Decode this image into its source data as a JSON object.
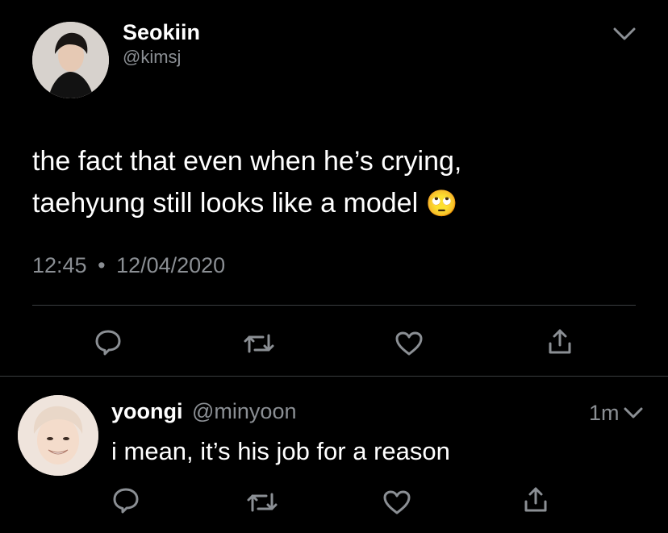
{
  "tweet": {
    "display_name": "Seokiin",
    "handle": "@kimsj",
    "text_line1": "the fact that even when he’s crying,",
    "text_line2": "taehyung still looks like a model",
    "emoji": "🙄",
    "time": "12:45",
    "separator": "•",
    "date": "12/04/2020"
  },
  "reply": {
    "display_name": "yoongi",
    "handle": "@minyoon",
    "age": "1m",
    "text": "i mean, it’s his job for a reason"
  },
  "colors": {
    "background": "#000000",
    "text": "#ffffff",
    "muted": "#8b8f94",
    "divider": "#3a3d40"
  },
  "icons": [
    "chevron-down-icon",
    "reply-icon",
    "retweet-icon",
    "like-icon",
    "share-icon"
  ]
}
